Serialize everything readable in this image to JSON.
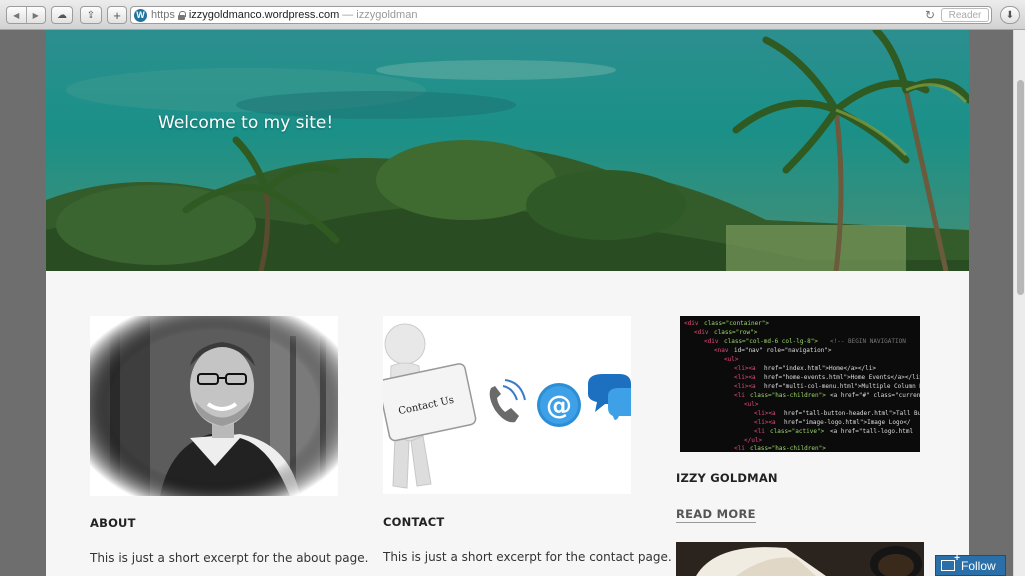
{
  "browser": {
    "scheme": "https",
    "host": "izzygoldmanco.wordpress.com",
    "page_title": "— izzygoldman",
    "reader_label": "Reader"
  },
  "hero": {
    "title": "Welcome to my site!"
  },
  "cards": [
    {
      "heading": "ABOUT",
      "excerpt": "This is just a short excerpt for the about page."
    },
    {
      "heading": "CONTACT",
      "excerpt": "This is just a short excerpt for the contact page.",
      "image_label": "Contact Us"
    },
    {
      "heading": "IZZY GOLDMAN",
      "read_more": "READ MORE"
    }
  ],
  "follow_label": "Follow",
  "colors": {
    "follow_bg": "#2a6fa8",
    "hero_water": "#1f8e88",
    "content_bg": "#f6f6f6"
  }
}
